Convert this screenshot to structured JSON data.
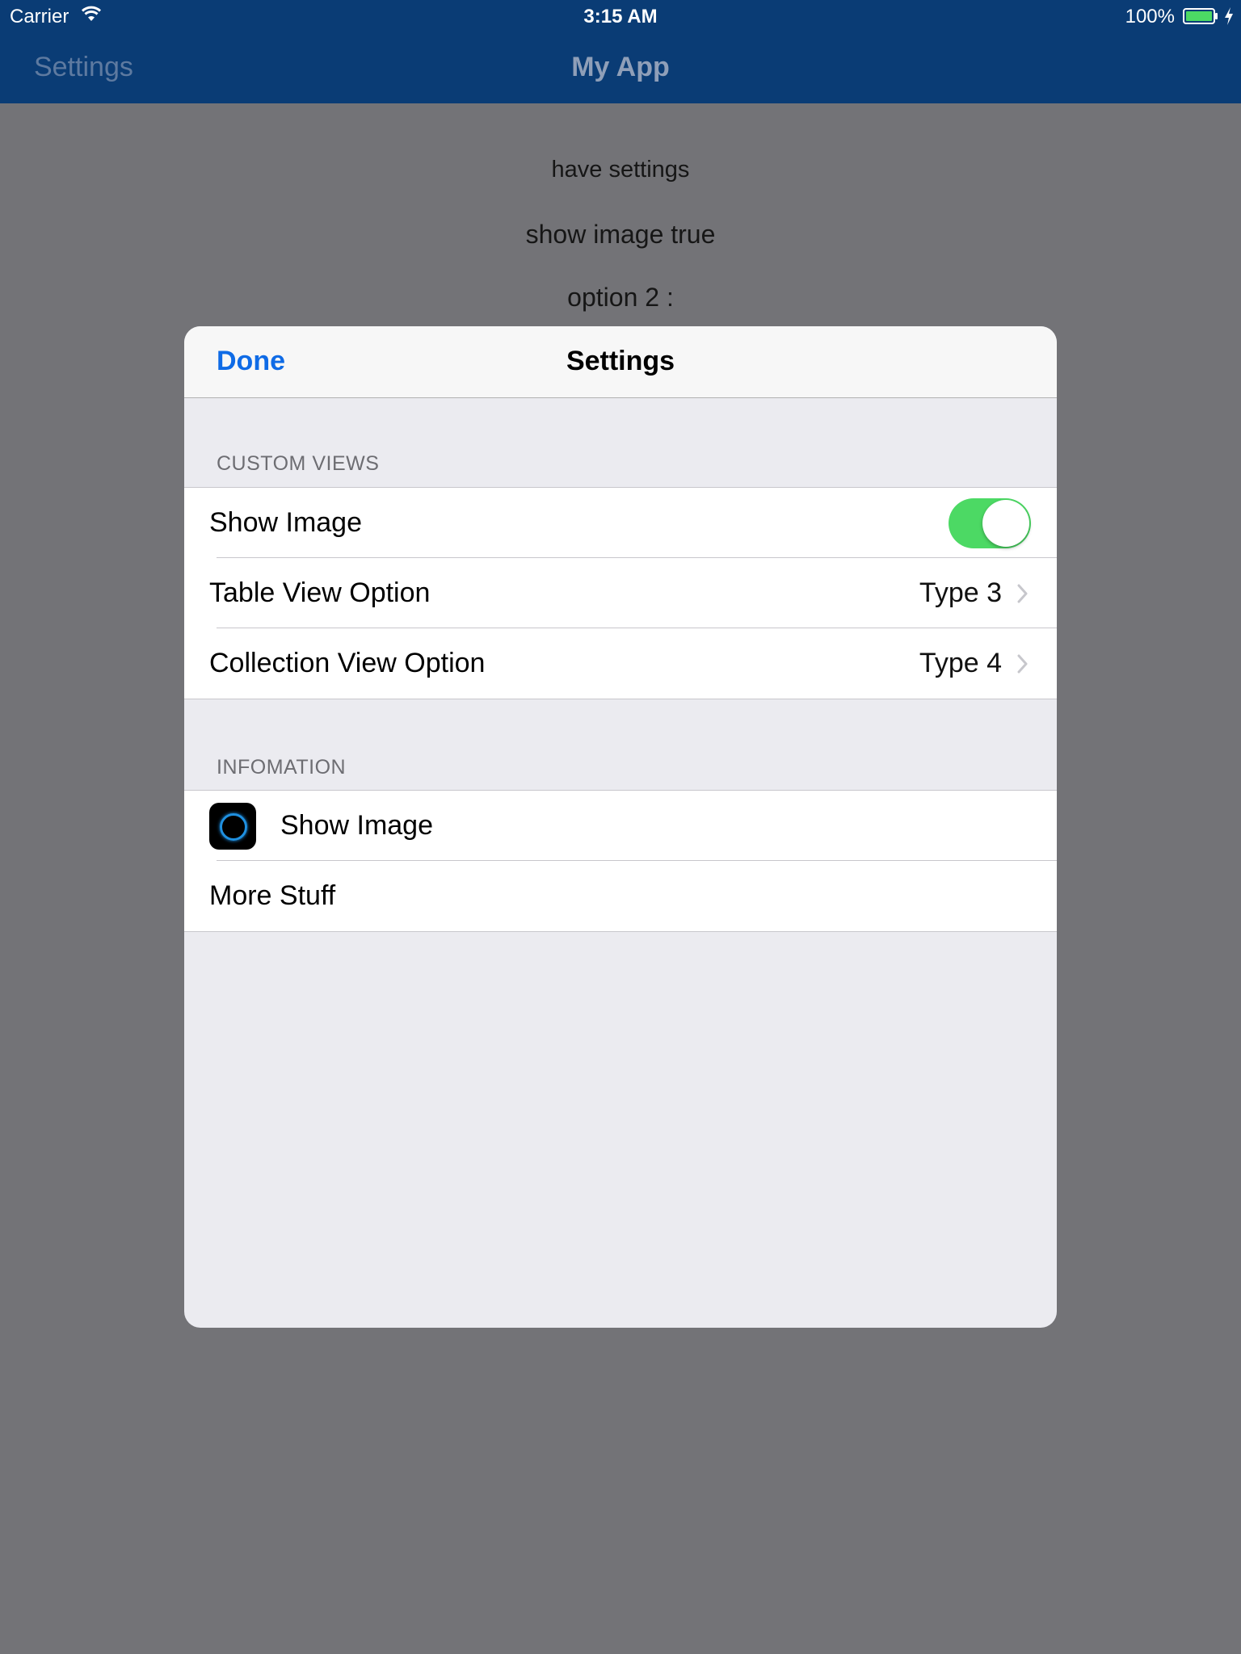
{
  "status_bar": {
    "carrier": "Carrier",
    "time": "3:15 AM",
    "battery_percent": "100%",
    "wifi_icon": "wifi-icon",
    "battery_icon": "battery-full-icon",
    "charging_icon": "bolt-icon"
  },
  "nav_bar": {
    "back_label": "Settings",
    "title": "My App",
    "color": "#0a3c75"
  },
  "background_lines": [
    "have settings",
    "show image true",
    "option 2 :"
  ],
  "modal": {
    "done_label": "Done",
    "title": "Settings",
    "sections": [
      {
        "header": "CUSTOM VIEWS",
        "rows": [
          {
            "label": "Show Image",
            "control": "toggle",
            "toggle_on": true
          },
          {
            "label": "Table View Option",
            "detail": "Type 3",
            "accessory": "chevron-right-icon"
          },
          {
            "label": "Collection View Option",
            "detail": "Type 4",
            "accessory": "chevron-right-icon"
          }
        ]
      },
      {
        "header": "INFOMATION",
        "rows": [
          {
            "label": "Show Image",
            "icon": "app-icon"
          },
          {
            "label": "More Stuff"
          }
        ]
      }
    ]
  },
  "colors": {
    "accent": "#0f6be6",
    "toggle_on": "#4cd964",
    "dim_overlay": "#737377"
  }
}
